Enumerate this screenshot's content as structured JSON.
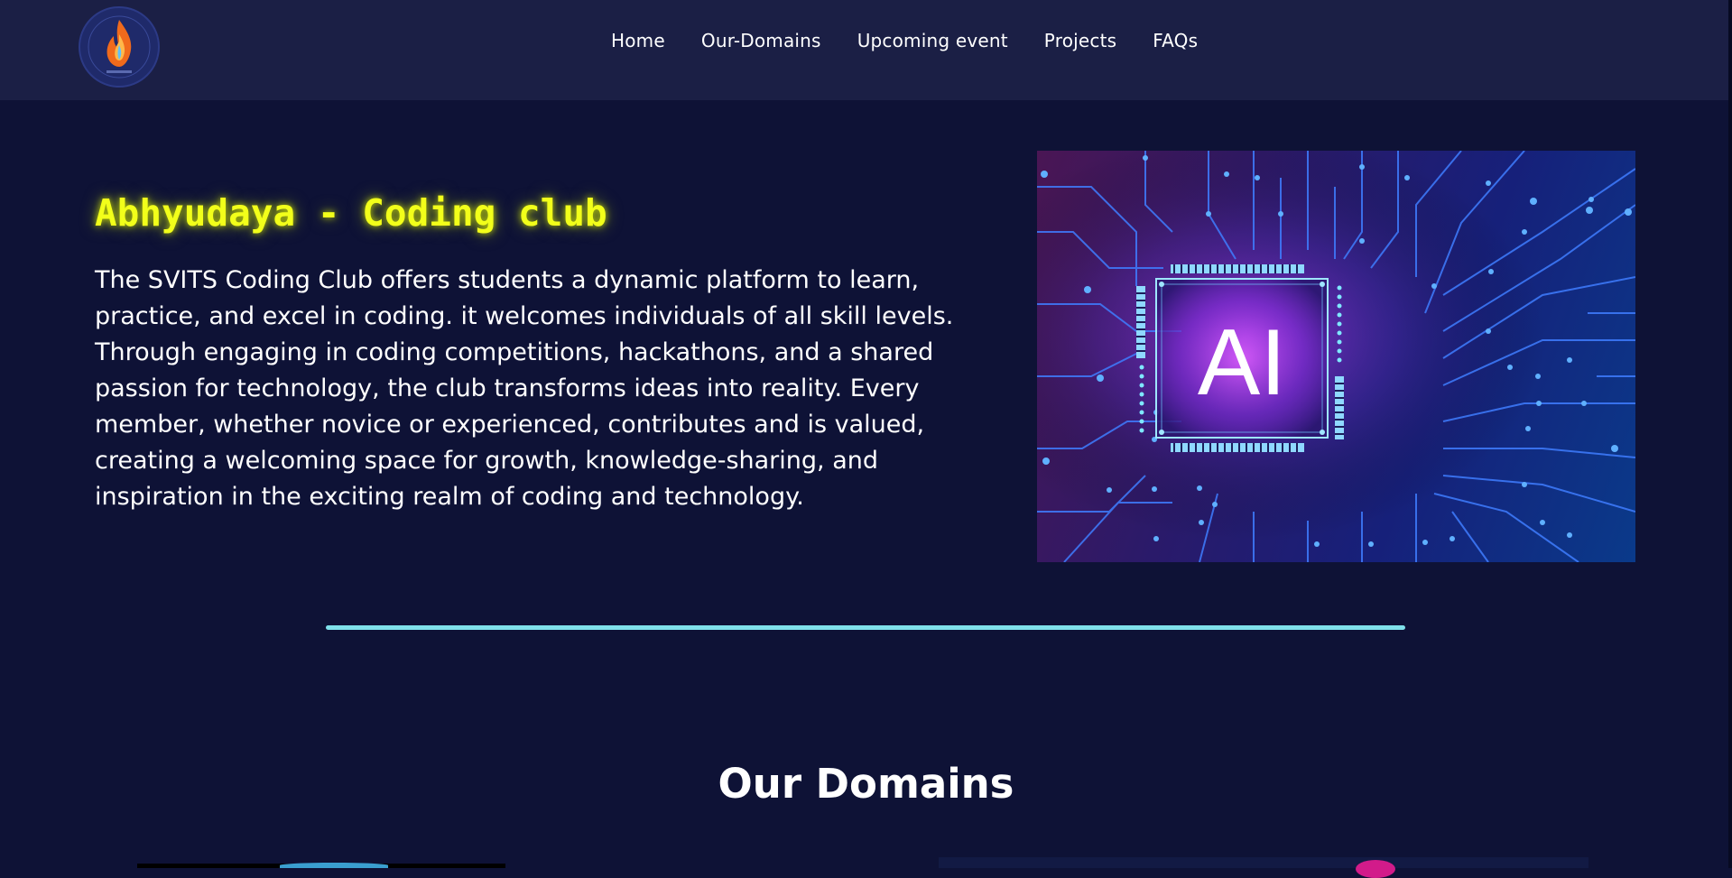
{
  "header": {
    "logo_icon": "college-flame-logo-icon",
    "nav": [
      {
        "label": "Home"
      },
      {
        "label": "Our-Domains"
      },
      {
        "label": "Upcoming event"
      },
      {
        "label": "Projects"
      },
      {
        "label": "FAQs"
      }
    ]
  },
  "hero": {
    "title": "Abhyudaya - Coding club",
    "description": "The SVITS Coding Club offers students a dynamic platform to learn, practice, and excel in coding. it welcomes individuals of all skill levels. Through engaging in coding competitions, hackathons, and a shared passion for technology, the club transforms ideas into reality. Every member, whether novice or experienced, contributes and is valued, creating a welcoming space for growth, knowledge-sharing, and inspiration in the exciting realm of coding and technology.",
    "image_chip_text": "AI"
  },
  "domains": {
    "title": "Our Domains"
  },
  "colors": {
    "background": "#0e1236",
    "header_bg": "#1b1f45",
    "title_glow": "#f2ff1a",
    "divider": "#7fe0ea",
    "circuit_accent": "#4aa8ff"
  }
}
